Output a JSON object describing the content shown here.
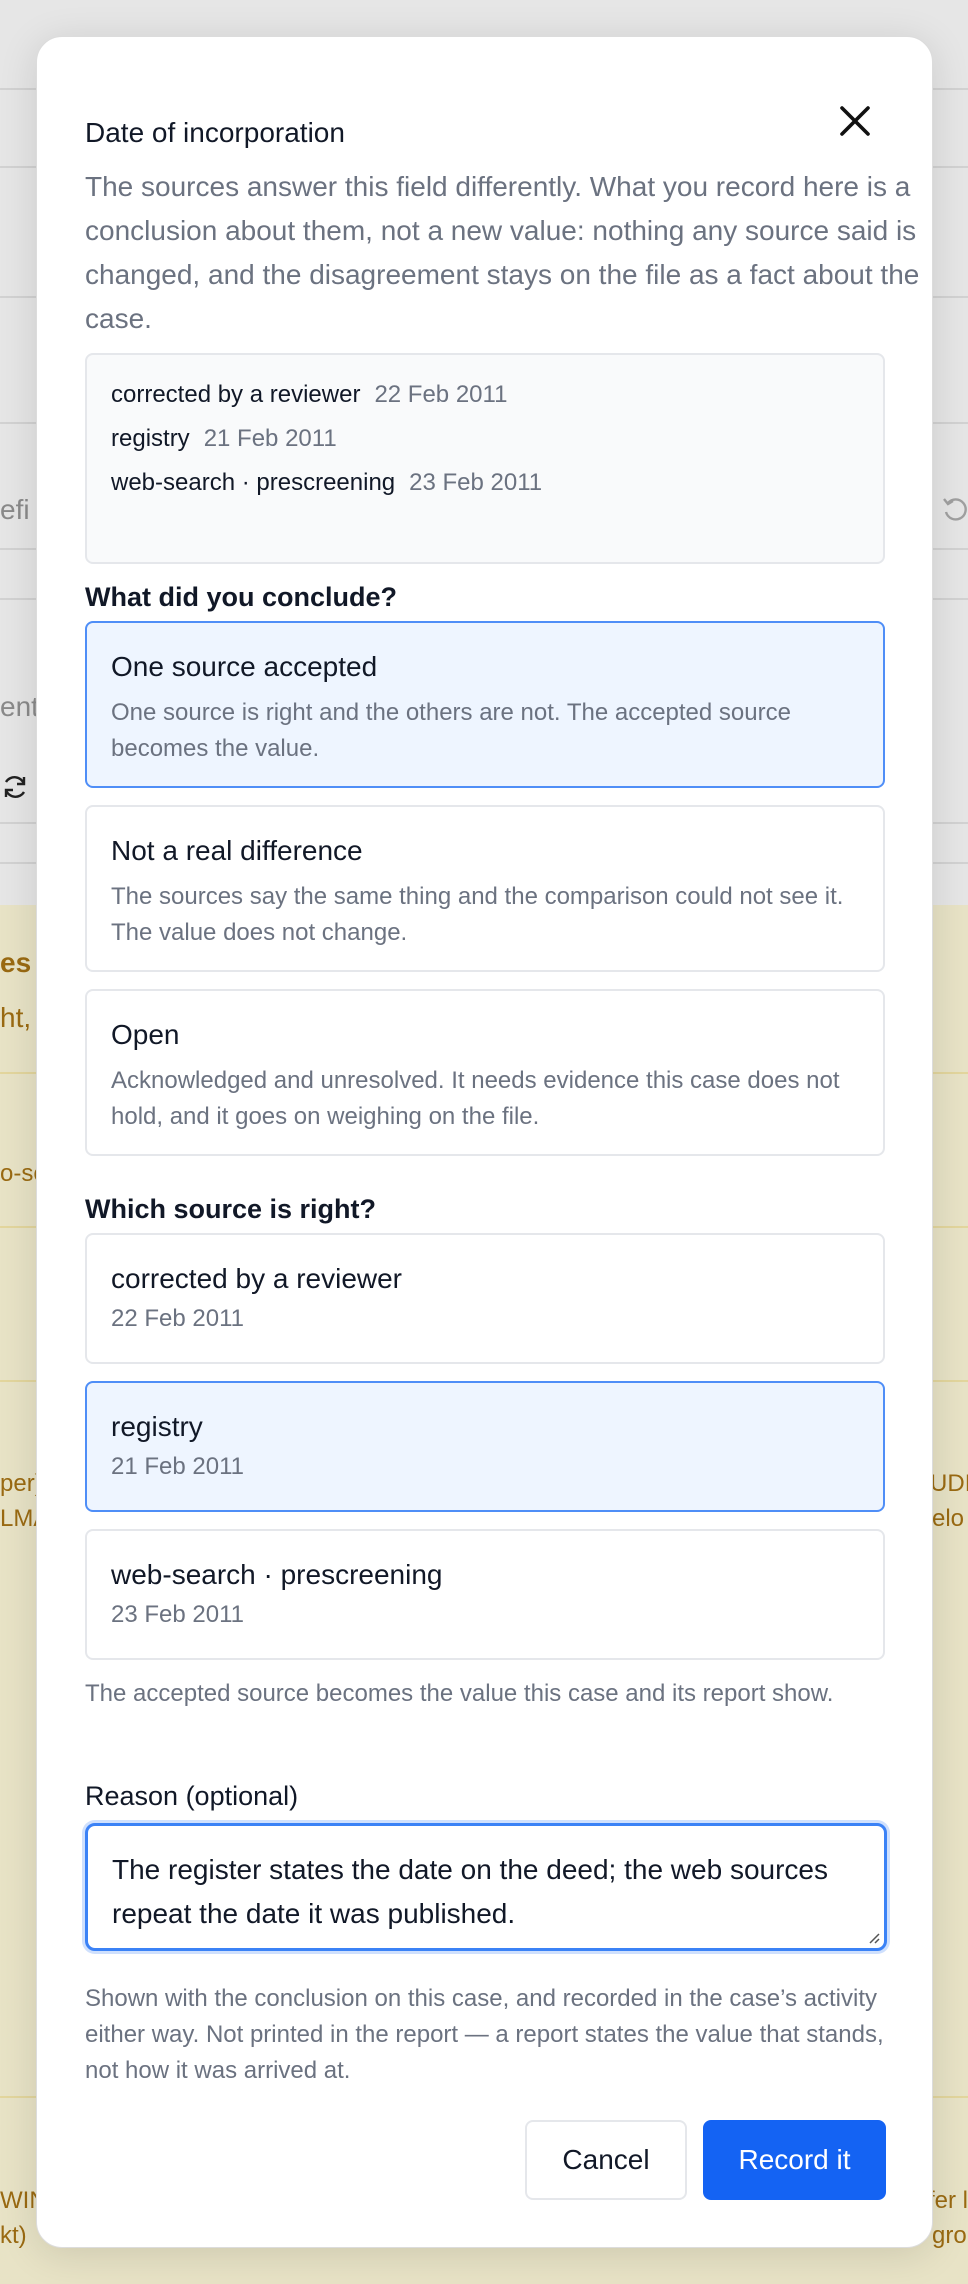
{
  "background": {
    "fragments": [
      {
        "text": "efi",
        "tone": "grey"
      },
      {
        "text": "ents",
        "tone": "grey"
      },
      {
        "text": "es",
        "tone": "brown"
      },
      {
        "text": "ht,",
        "tone": "brown"
      },
      {
        "text": "o-se",
        "tone": "brown"
      },
      {
        "text": "per)",
        "tone": "brown"
      },
      {
        "text": "LMA",
        "tone": "brown"
      },
      {
        "text": "UDI",
        "tone": "brown"
      },
      {
        "text": "elo",
        "tone": "brown"
      },
      {
        "text": "WIN",
        "tone": "brown"
      },
      {
        "text": "kt)",
        "tone": "brown"
      },
      {
        "text": "fer l",
        "tone": "brown"
      },
      {
        "text": "gro",
        "tone": "brown"
      }
    ],
    "icons": [
      "undo-icon",
      "refresh-icon"
    ]
  },
  "dialog": {
    "title": "Date of incorporation",
    "close_icon": "close-icon",
    "intro": "The sources answer this field differently. What you record here is a conclusion about them, not a new value: nothing any source said is changed, and the disagreement stays on the file as a fact about the case.",
    "sources": [
      {
        "name": "corrected by a reviewer",
        "date": "22 Feb 2011"
      },
      {
        "name": "registry",
        "date": "21 Feb 2011"
      },
      {
        "name": "web-search · prescreening",
        "date": "23 Feb 2011"
      }
    ],
    "conclusion_label": "What did you conclude?",
    "conclusions": [
      {
        "title": "One source accepted",
        "description": "One source is right and the others are not. The accepted source becomes the value.",
        "selected": true
      },
      {
        "title": "Not a real difference",
        "description": "The sources say the same thing and the comparison could not see it. The value does not change.",
        "selected": false
      },
      {
        "title": "Open",
        "description": "Acknowledged and unresolved. It needs evidence this case does not hold, and it goes on weighing on the file.",
        "selected": false
      }
    ],
    "source_choice_label": "Which source is right?",
    "source_choices": [
      {
        "name": "corrected by a reviewer",
        "date": "22 Feb 2011",
        "selected": false
      },
      {
        "name": "registry",
        "date": "21 Feb 2011",
        "selected": true
      },
      {
        "name": "web-search · prescreening",
        "date": "23 Feb 2011",
        "selected": false
      }
    ],
    "source_choice_note": "The accepted source becomes the value this case and its report show.",
    "reason_label": "Reason (optional)",
    "reason_value": "The register states the date on the deed; the web sources repeat the date it was published.",
    "reason_note": "Shown with the conclusion on this case, and recorded in the case’s activity either way. Not printed in the report — a report states the value that stands, not how it was arrived at.",
    "cancel_label": "Cancel",
    "submit_label": "Record it",
    "colors": {
      "accent": "#1463f3",
      "selected_bg": "#eef5ff",
      "selected_border": "#4f8ef7"
    }
  }
}
